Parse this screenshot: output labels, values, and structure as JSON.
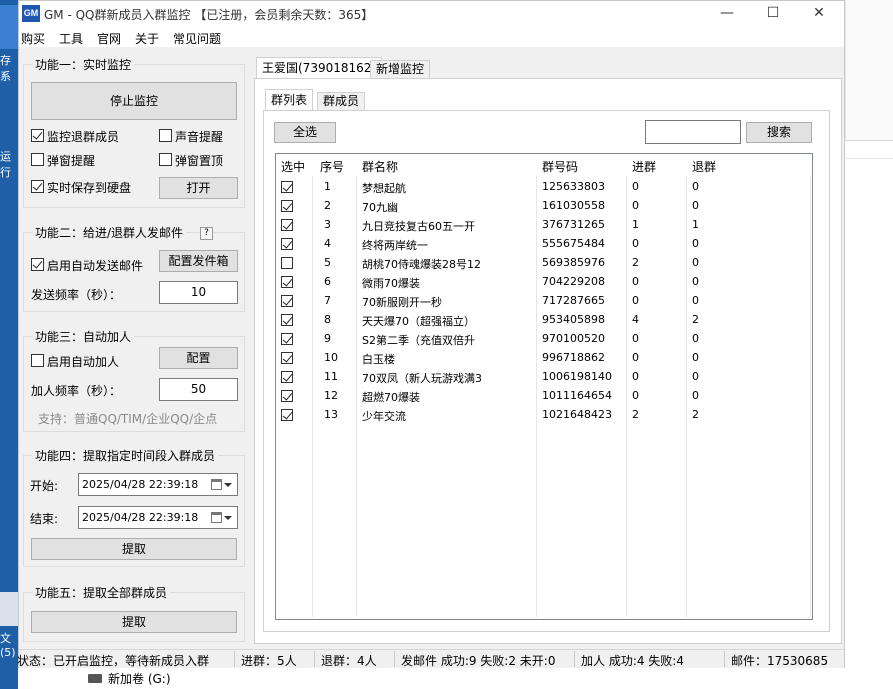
{
  "window": {
    "app_icon": "GM",
    "title": "GM - QQ群新成员入群监控 【已注册，会员剩余天数：365】",
    "minimize": "—",
    "maximize": "☐",
    "close": "✕"
  },
  "menu": [
    "购买",
    "工具",
    "官网",
    "关于",
    "常见问题"
  ],
  "f1": {
    "title": "功能一：实时监控",
    "stop_btn": "停止监控",
    "cb_exit": "监控退群成员",
    "cb_sound": "声音提醒",
    "cb_popup": "弹窗提醒",
    "cb_top": "弹窗置顶",
    "cb_save": "实时保存到硬盘",
    "open_btn": "打开"
  },
  "f2": {
    "title": "功能二：给进/退群人发邮件",
    "help": "?",
    "cb_auto": "启用自动发送邮件",
    "config_btn": "配置发件箱",
    "freq_label": "发送频率（秒）：",
    "freq_value": "10"
  },
  "f3": {
    "title": "功能三：自动加人",
    "cb_auto": "启用自动加人",
    "config_btn": "配置",
    "freq_label": "加人频率（秒）：",
    "freq_value": "50",
    "support": "支持：普通QQ/TIM/企业QQ/企点"
  },
  "f4": {
    "title": "功能四：提取指定时间段入群成员",
    "start_label": "开始:",
    "start_value": "2025/04/28 22:39:18",
    "end_label": "结束:",
    "end_value": "2025/04/28 22:39:18",
    "extract_btn": "提取"
  },
  "f5": {
    "title": "功能五：提取全部群成员",
    "extract_btn": "提取"
  },
  "tabs": {
    "account": "王爱国(739018162)",
    "add": "新增监控"
  },
  "subtabs": {
    "groups": "群列表",
    "members": "群成员"
  },
  "toolbar": {
    "select_all": "全选",
    "search_value": "",
    "search_btn": "搜索"
  },
  "grid": {
    "headers": [
      "选中",
      "序号",
      "群名称",
      "群号码",
      "进群",
      "退群"
    ],
    "rows": [
      {
        "checked": true,
        "no": "1",
        "name": "梦想起航",
        "id": "125633803",
        "join": "0",
        "exit": "0"
      },
      {
        "checked": true,
        "no": "2",
        "name": "70九幽",
        "id": "161030558",
        "join": "0",
        "exit": "0"
      },
      {
        "checked": true,
        "no": "3",
        "name": "九日竞技复古60五一开",
        "id": "376731265",
        "join": "1",
        "exit": "1"
      },
      {
        "checked": true,
        "no": "4",
        "name": "终将两岸统一",
        "id": "555675484",
        "join": "0",
        "exit": "0"
      },
      {
        "checked": false,
        "no": "5",
        "name": "胡桃70侍魂爆装28号12",
        "id": "569385976",
        "join": "2",
        "exit": "0"
      },
      {
        "checked": true,
        "no": "6",
        "name": "微雨70爆装",
        "id": "704229208",
        "join": "0",
        "exit": "0"
      },
      {
        "checked": true,
        "no": "7",
        "name": "70新服刚开一秒",
        "id": "717287665",
        "join": "0",
        "exit": "0"
      },
      {
        "checked": true,
        "no": "8",
        "name": "天天爆70（超强福立）",
        "id": "953405898",
        "join": "4",
        "exit": "2"
      },
      {
        "checked": true,
        "no": "9",
        "name": "S2第二季（充值双倍升",
        "id": "970100520",
        "join": "0",
        "exit": "0"
      },
      {
        "checked": true,
        "no": "10",
        "name": "白玉楼",
        "id": "996718862",
        "join": "0",
        "exit": "0"
      },
      {
        "checked": true,
        "no": "11",
        "name": "70双凤（新人玩游戏满3",
        "id": "1006198140",
        "join": "0",
        "exit": "0"
      },
      {
        "checked": true,
        "no": "12",
        "name": "超燃70爆装",
        "id": "1011164654",
        "join": "0",
        "exit": "0"
      },
      {
        "checked": true,
        "no": "13",
        "name": "少年交流",
        "id": "1021648423",
        "join": "2",
        "exit": "2"
      }
    ]
  },
  "status": {
    "state": "状态：已开启监控，等待新成员入群",
    "join": "进群：5人",
    "exit": "退群：4人",
    "mail": "发邮件 成功:9 失败:2 未开:0",
    "add": "加人 成功:4 失败:4",
    "email": "邮件：17530685"
  },
  "desktop": {
    "left_text_1": "存系",
    "left_text_2": "运行",
    "left_text_3": "文\n(5)",
    "drive_label": "新加卷 (G:)"
  }
}
